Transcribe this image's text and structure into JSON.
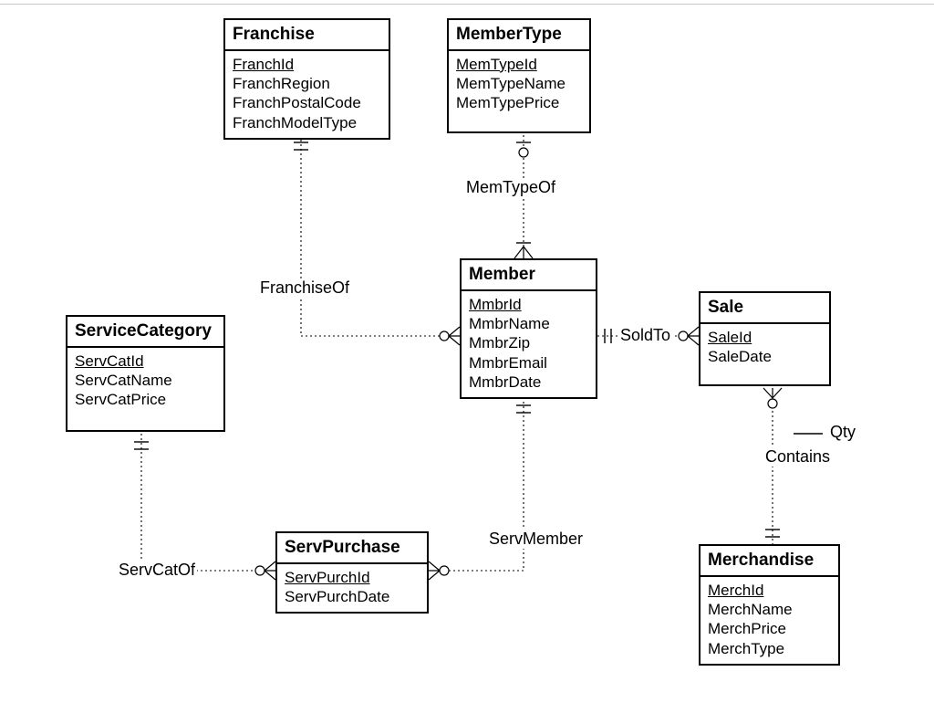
{
  "diagram_type": "Entity-Relationship Diagram (Crow's Foot)",
  "entities": {
    "franchise": {
      "name": "Franchise",
      "pk": "FranchId",
      "attrs": [
        "FranchRegion",
        "FranchPostalCode",
        "FranchModelType"
      ]
    },
    "membertype": {
      "name": "MemberType",
      "pk": "MemTypeId",
      "attrs": [
        "MemTypeName",
        "MemTypePrice"
      ]
    },
    "servicecategory": {
      "name": "ServiceCategory",
      "pk": "ServCatId",
      "attrs": [
        "ServCatName",
        "ServCatPrice"
      ]
    },
    "member": {
      "name": "Member",
      "pk": "MmbrId",
      "attrs": [
        "MmbrName",
        "MmbrZip",
        "MmbrEmail",
        "MmbrDate"
      ]
    },
    "sale": {
      "name": "Sale",
      "pk": "SaleId",
      "attrs": [
        "SaleDate"
      ]
    },
    "servpurchase": {
      "name": "ServPurchase",
      "pk": "ServPurchId",
      "attrs": [
        "ServPurchDate"
      ]
    },
    "merchandise": {
      "name": "Merchandise",
      "pk": "MerchId",
      "attrs": [
        "MerchName",
        "MerchPrice",
        "MerchType"
      ]
    }
  },
  "relationships": {
    "franchiseof": {
      "label": "FranchiseOf",
      "from": "Franchise",
      "to": "Member",
      "cardinality": "one-and-only-one to zero-or-many"
    },
    "memtypeof": {
      "label": "MemTypeOf",
      "from": "MemberType",
      "to": "Member",
      "cardinality": "zero-or-one to one-or-many"
    },
    "soldto": {
      "label": "SoldTo",
      "from": "Member",
      "to": "Sale",
      "cardinality": "one-and-only-one to zero-or-many"
    },
    "contains": {
      "label": "Contains",
      "from": "Sale",
      "to": "Merchandise",
      "cardinality": "zero-or-many to one-and-only-one",
      "attribute": "Qty"
    },
    "servcatof": {
      "label": "ServCatOf",
      "from": "ServiceCategory",
      "to": "ServPurchase",
      "cardinality": "one-and-only-one to zero-or-many"
    },
    "servmember": {
      "label": "ServMember",
      "from": "Member",
      "to": "ServPurchase",
      "cardinality": "one-and-only-one to zero-or-many"
    }
  },
  "rel_attr_qty": "Qty"
}
